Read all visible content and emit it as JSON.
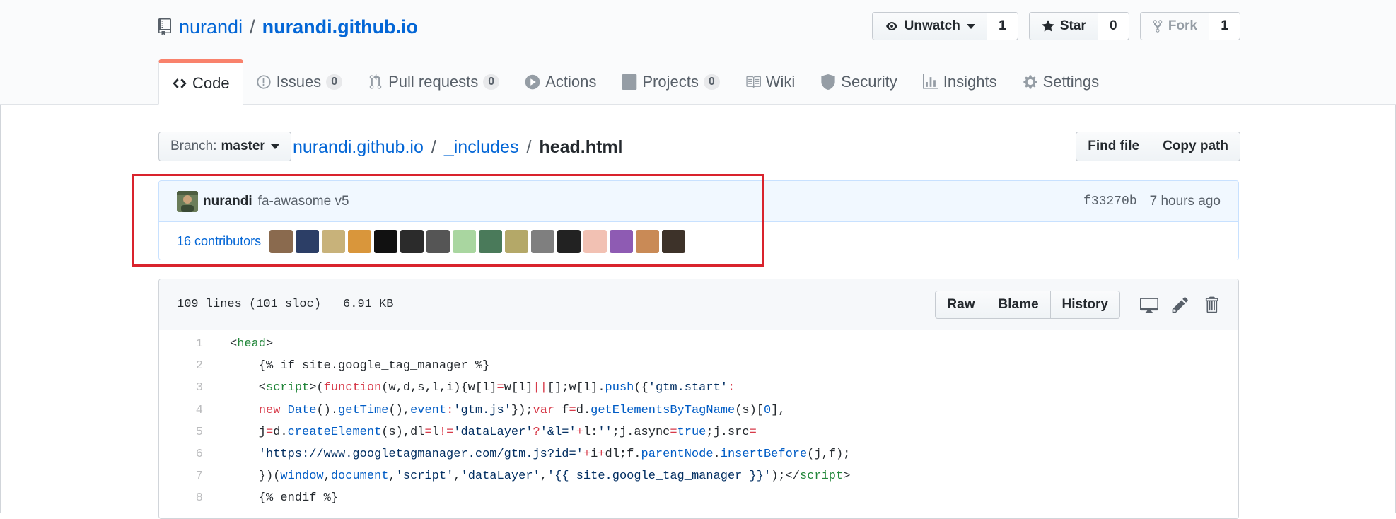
{
  "repo": {
    "owner": "nurandi",
    "separator": "/",
    "name": "nurandi.github.io"
  },
  "actions": {
    "watch": {
      "label": "Unwatch",
      "count": "1"
    },
    "star": {
      "label": "Star",
      "count": "0"
    },
    "fork": {
      "label": "Fork",
      "count": "1"
    }
  },
  "tabs": [
    {
      "label": "Code"
    },
    {
      "label": "Issues",
      "counter": "0"
    },
    {
      "label": "Pull requests",
      "counter": "0"
    },
    {
      "label": "Actions"
    },
    {
      "label": "Projects",
      "counter": "0"
    },
    {
      "label": "Wiki"
    },
    {
      "label": "Security"
    },
    {
      "label": "Insights"
    },
    {
      "label": "Settings"
    }
  ],
  "branch": {
    "prefix": "Branch:",
    "name": "master"
  },
  "breadcrumb": {
    "root": "nurandi.github.io",
    "sep": "/",
    "folder": "_includes",
    "file": "head.html"
  },
  "file_nav": {
    "find_file": "Find file",
    "copy_path": "Copy path"
  },
  "commit": {
    "author": "nurandi",
    "message": "fa-awasome v5",
    "sha": "f33270b",
    "time": "7 hours ago",
    "contributors_count": "16",
    "contributors_label": "contributors",
    "avatar_colors": [
      "#8a6a4e",
      "#2c3e66",
      "#c8b27a",
      "#d9963b",
      "#111111",
      "#2b2b2b",
      "#555555",
      "#a9d6a0",
      "#4a7a5a",
      "#b4a868",
      "#7f7f7f",
      "#222222",
      "#f2c1b3",
      "#8e5bb3",
      "#c98a56",
      "#3d3229"
    ]
  },
  "file": {
    "lines_info": "109 lines (101 sloc)",
    "size": "6.91 KB",
    "raw": "Raw",
    "blame": "Blame",
    "history": "History"
  },
  "code": {
    "line_numbers": [
      "1",
      "2",
      "3",
      "4",
      "5",
      "6",
      "7",
      "8"
    ],
    "l1_open": "<",
    "l1_tag": "head",
    "l1_close": ">",
    "l2": "    {% if site.google_tag_manager %}",
    "l3": [
      {
        "t": "    <",
        "c": ""
      },
      {
        "t": "script",
        "c": "t-tag"
      },
      {
        "t": ">(",
        "c": ""
      },
      {
        "t": "function",
        "c": "t-kw"
      },
      {
        "t": "(w,d,s,l,i){w[l]",
        "c": ""
      },
      {
        "t": "=",
        "c": "t-kw"
      },
      {
        "t": "w[l]",
        "c": ""
      },
      {
        "t": "||",
        "c": "t-kw"
      },
      {
        "t": "[];w[l].",
        "c": ""
      },
      {
        "t": "push",
        "c": "t-c"
      },
      {
        "t": "({",
        "c": ""
      },
      {
        "t": "'gtm.start'",
        "c": "t-str"
      },
      {
        "t": ":",
        "c": "t-kw"
      }
    ],
    "l4": [
      {
        "t": "    ",
        "c": ""
      },
      {
        "t": "new",
        "c": "t-kw"
      },
      {
        "t": " ",
        "c": ""
      },
      {
        "t": "Date",
        "c": "t-c"
      },
      {
        "t": "().",
        "c": ""
      },
      {
        "t": "getTime",
        "c": "t-c"
      },
      {
        "t": "(),",
        "c": ""
      },
      {
        "t": "event",
        "c": "t-c"
      },
      {
        "t": ":",
        "c": "t-kw"
      },
      {
        "t": "'gtm.js'",
        "c": "t-str"
      },
      {
        "t": "});",
        "c": ""
      },
      {
        "t": "var",
        "c": "t-kw"
      },
      {
        "t": " f",
        "c": ""
      },
      {
        "t": "=",
        "c": "t-kw"
      },
      {
        "t": "d.",
        "c": ""
      },
      {
        "t": "getElementsByTagName",
        "c": "t-c"
      },
      {
        "t": "(s)[",
        "c": ""
      },
      {
        "t": "0",
        "c": "t-c"
      },
      {
        "t": "],",
        "c": ""
      }
    ],
    "l5": [
      {
        "t": "    j",
        "c": ""
      },
      {
        "t": "=",
        "c": "t-kw"
      },
      {
        "t": "d.",
        "c": ""
      },
      {
        "t": "createElement",
        "c": "t-c"
      },
      {
        "t": "(s),dl",
        "c": ""
      },
      {
        "t": "=",
        "c": "t-kw"
      },
      {
        "t": "l",
        "c": ""
      },
      {
        "t": "!=",
        "c": "t-kw"
      },
      {
        "t": "'dataLayer'",
        "c": "t-str"
      },
      {
        "t": "?",
        "c": "t-kw"
      },
      {
        "t": "'&l='",
        "c": "t-str"
      },
      {
        "t": "+",
        "c": "t-kw"
      },
      {
        "t": "l:",
        "c": ""
      },
      {
        "t": "''",
        "c": "t-str"
      },
      {
        "t": ";j.async",
        "c": ""
      },
      {
        "t": "=",
        "c": "t-kw"
      },
      {
        "t": "true",
        "c": "t-c"
      },
      {
        "t": ";j.src",
        "c": ""
      },
      {
        "t": "=",
        "c": "t-kw"
      }
    ],
    "l6": [
      {
        "t": "    ",
        "c": ""
      },
      {
        "t": "'https://www.googletagmanager.com/gtm.js?id='",
        "c": "t-str"
      },
      {
        "t": "+",
        "c": "t-kw"
      },
      {
        "t": "i",
        "c": ""
      },
      {
        "t": "+",
        "c": "t-kw"
      },
      {
        "t": "dl;f.",
        "c": ""
      },
      {
        "t": "parentNode",
        "c": "t-c"
      },
      {
        "t": ".",
        "c": ""
      },
      {
        "t": "insertBefore",
        "c": "t-c"
      },
      {
        "t": "(j,f);",
        "c": ""
      }
    ],
    "l7": [
      {
        "t": "    })(",
        "c": ""
      },
      {
        "t": "window",
        "c": "t-c"
      },
      {
        "t": ",",
        "c": ""
      },
      {
        "t": "document",
        "c": "t-c"
      },
      {
        "t": ",",
        "c": ""
      },
      {
        "t": "'script'",
        "c": "t-str"
      },
      {
        "t": ",",
        "c": ""
      },
      {
        "t": "'dataLayer'",
        "c": "t-str"
      },
      {
        "t": ",",
        "c": ""
      },
      {
        "t": "'{{ site.google_tag_manager }}'",
        "c": "t-str"
      },
      {
        "t": ");</",
        "c": ""
      },
      {
        "t": "script",
        "c": "t-tag"
      },
      {
        "t": ">",
        "c": ""
      }
    ],
    "l8": "    {% endif %}"
  }
}
